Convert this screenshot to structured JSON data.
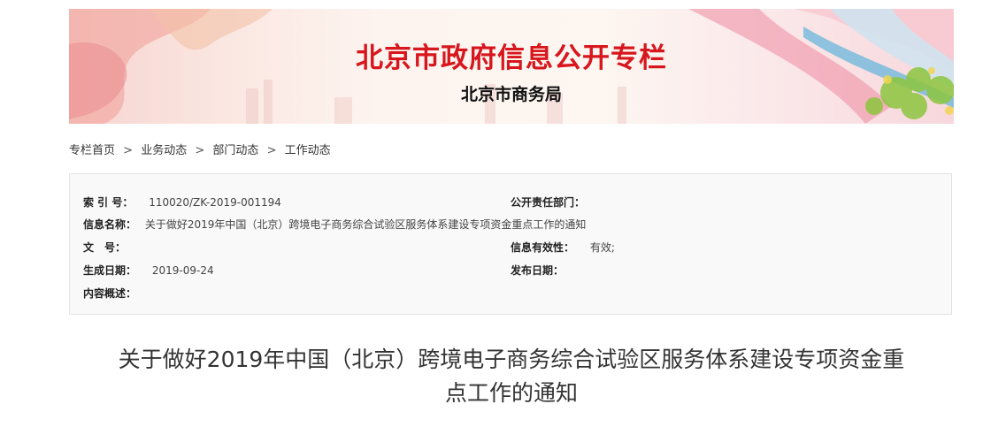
{
  "banner": {
    "title": "北京市政府信息公开专栏",
    "subtitle": "北京市商务局"
  },
  "breadcrumb": {
    "items": [
      "专栏首页",
      "业务动态",
      "部门动态",
      "工作动态"
    ],
    "separator": ">"
  },
  "info": {
    "index_label": "索 引 号：",
    "index_value": "110020/ZK-2019-001194",
    "dept_label": "公开责任部门：",
    "dept_value": "",
    "name_label": "信息名称：",
    "name_value": "关于做好2019年中国（北京）跨境电子商务综合试验区服务体系建设专项资金重点工作的通知",
    "docno_label": "文　号：",
    "docno_value": "",
    "validity_label": "信息有效性：",
    "validity_value": "有效;",
    "created_label": "生成日期：",
    "created_value": "2019-09-24",
    "published_label": "发布日期：",
    "published_value": "",
    "summary_label": "内容概述：",
    "summary_value": ""
  },
  "article": {
    "title_line1": "关于做好2019年中国（北京）跨境电子商务综合试验区服务体系建设专项资金重",
    "title_line2": "点工作的通知"
  },
  "colors": {
    "banner_title": "#d7161d",
    "banner_subtitle": "#111111",
    "infobox_bg": "#f9f9f9",
    "infobox_border": "#e3e3e3"
  }
}
